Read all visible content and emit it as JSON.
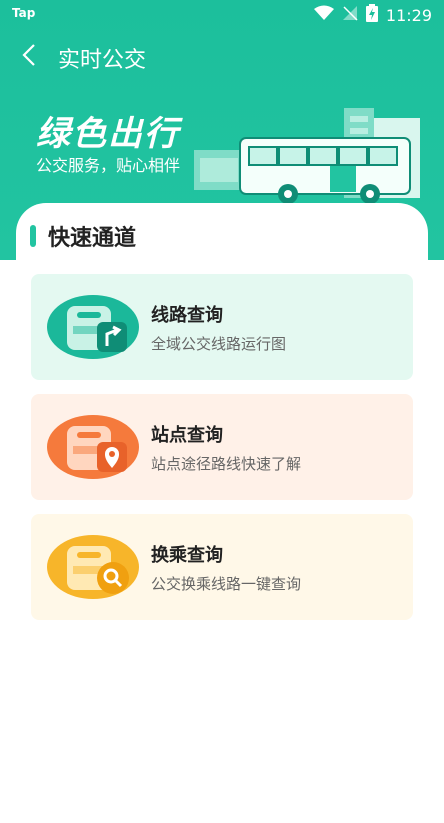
{
  "status_bar": {
    "carrier": "Tap",
    "time": "11:29"
  },
  "header": {
    "title": "实时公交"
  },
  "banner": {
    "slogan": "绿色出行",
    "subtitle": "公交服务，贴心相伴"
  },
  "section": {
    "title": "快速通道"
  },
  "cards": [
    {
      "name": "线路查询",
      "desc": "全域公交线路运行图",
      "color": "#1bb89a"
    },
    {
      "name": "站点查询",
      "desc": "站点途径路线快速了解",
      "color": "#f57a3c"
    },
    {
      "name": "换乘查询",
      "desc": "公交换乘线路一键查询",
      "color": "#f7b52a"
    }
  ]
}
